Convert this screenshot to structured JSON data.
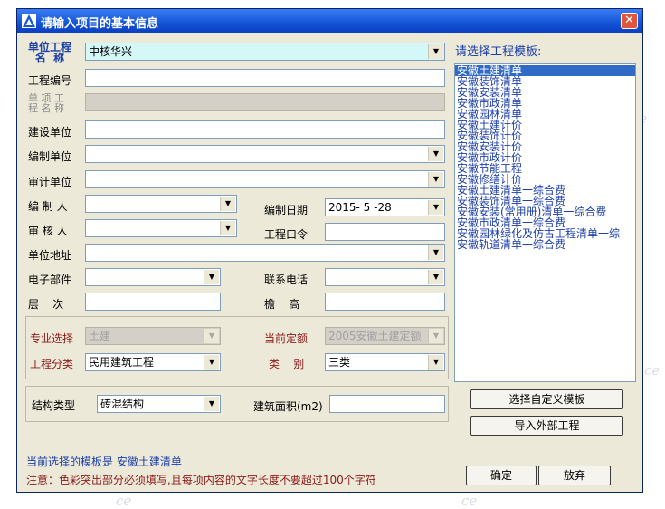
{
  "watermark": "ce",
  "window": {
    "title": "请输入项目的基本信息",
    "close_glyph": "✕"
  },
  "form": {
    "unit_project_label": "单位工程\n名  称",
    "unit_project_value": "中核华兴",
    "project_no_label": "工程编号",
    "sub_project_label": "单 项 工\n程 名 称",
    "builder_label": "建设单位",
    "compiler_unit_label": "编制单位",
    "auditor_unit_label": "审计单位",
    "compiler_label": "编 制 人",
    "reviewer_label": "审 核 人",
    "compile_date_label": "编制日期",
    "compile_date_value": "2015- 5 -28",
    "password_label": "工程口令",
    "address_label": "单位地址",
    "email_label": "电子部件",
    "phone_label": "联系电话",
    "floors_label": "层    次",
    "eave_label": "檐    高"
  },
  "specialty": {
    "major_label": "专业选择",
    "major_value": "土建",
    "quota_label": "当前定额",
    "quota_value": "2005安徽土建定额",
    "category_label": "工程分类",
    "category_value": "民用建筑工程",
    "type_label": "类    别",
    "type_value": "三类"
  },
  "structure": {
    "type_label": "结构类型",
    "type_value": "砖混结构",
    "area_label": "建筑面积(m2)"
  },
  "template": {
    "heading": "请选择工程模板:",
    "items": [
      "安徽土建清单",
      "安徽装饰清单",
      "安徽安装清单",
      "安徽市政清单",
      "安徽园林清单",
      "安徽土建计价",
      "安徽装饰计价",
      "安徽安装计价",
      "安徽市政计价",
      "安徽节能工程",
      "安徽修缮计价",
      "安徽土建清单一综合费",
      "安徽装饰清单一综合费",
      "安徽安装(常用册)清单一综合费",
      "安徽市政清单一综合费",
      "安徽园林绿化及仿古工程清单一综",
      "安徽轨道清单一综合费"
    ]
  },
  "buttons": {
    "custom_template": "选择自定义模板",
    "import_external": "导入外部工程",
    "ok": "确定",
    "cancel": "放弃"
  },
  "footer": {
    "current_template": "当前选择的模板是 安徽土建清单",
    "note": "注意：色彩突出部分必须填写,且每项内容的文字长度不要超过100个字符"
  },
  "icons": {
    "app": "app-logo-icon",
    "dropdown": "dropdown-arrow-icon",
    "close": "close-icon"
  }
}
